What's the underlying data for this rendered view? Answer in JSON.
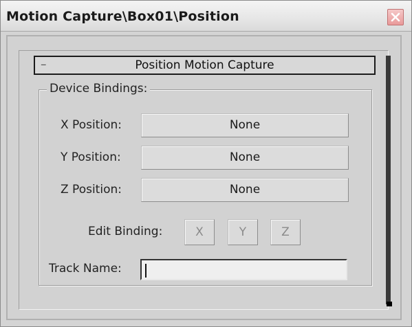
{
  "window": {
    "title": "Motion Capture\\Box01\\Position"
  },
  "rollout": {
    "collapse_symbol": "–",
    "title": "Position Motion Capture"
  },
  "device_bindings": {
    "group_label": "Device Bindings:",
    "rows": [
      {
        "label": "X Position:",
        "value": "None"
      },
      {
        "label": "Y Position:",
        "value": "None"
      },
      {
        "label": "Z Position:",
        "value": "None"
      }
    ]
  },
  "edit_binding": {
    "label": "Edit Binding:",
    "buttons": [
      "X",
      "Y",
      "Z"
    ]
  },
  "track_name": {
    "label": "Track Name:",
    "value": ""
  },
  "icons": {
    "close": "close-icon"
  },
  "colors": {
    "close_button": "#e99a9a",
    "window_bg": "#d4d4d4"
  }
}
